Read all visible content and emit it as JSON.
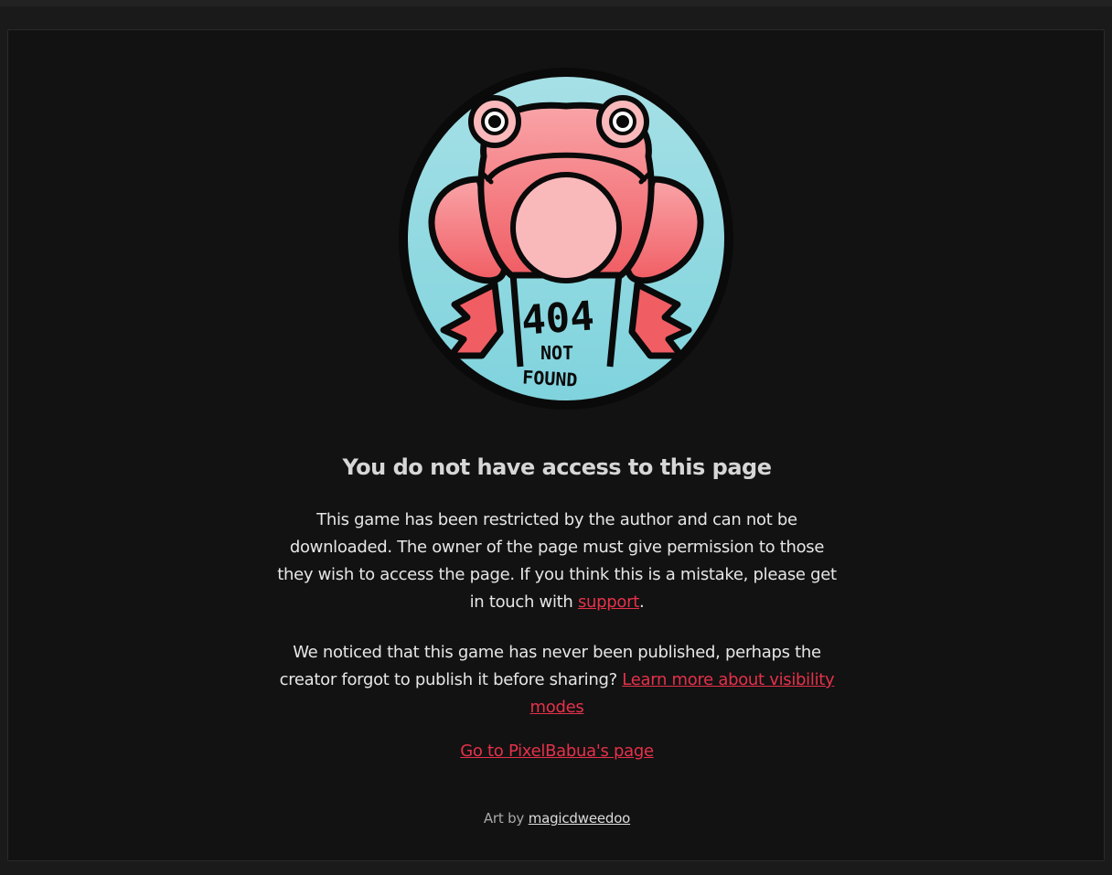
{
  "illustration": {
    "text_top": "404",
    "text_middle": "NOT",
    "text_bottom": "FOUND",
    "colors": {
      "background": "#88d6de",
      "frog_body": "#f47a7e",
      "frog_belly": "#f9b9bb",
      "outline": "#0a0a0a"
    }
  },
  "heading": "You do not have access to this page",
  "restricted_message": {
    "text": "This game has been restricted by the author and can not be downloaded. The owner of the page must give permission to those they wish to access the page. If you think this is a mistake, please get in touch with ",
    "link_label": "support",
    "suffix": "."
  },
  "unpublished_message": {
    "text": "We noticed that this game has never been published, perhaps the creator forgot to publish it before sharing? ",
    "link_label": "Learn more about visibility modes"
  },
  "owner_link_label": "Go to PixelBabua's page",
  "credit": {
    "prefix": "Art by ",
    "artist": "magicdweedoo"
  },
  "colors": {
    "page_background": "#1a1a1a",
    "panel_background": "#121212",
    "link": "#e5314a",
    "heading": "#d6d6d6"
  }
}
